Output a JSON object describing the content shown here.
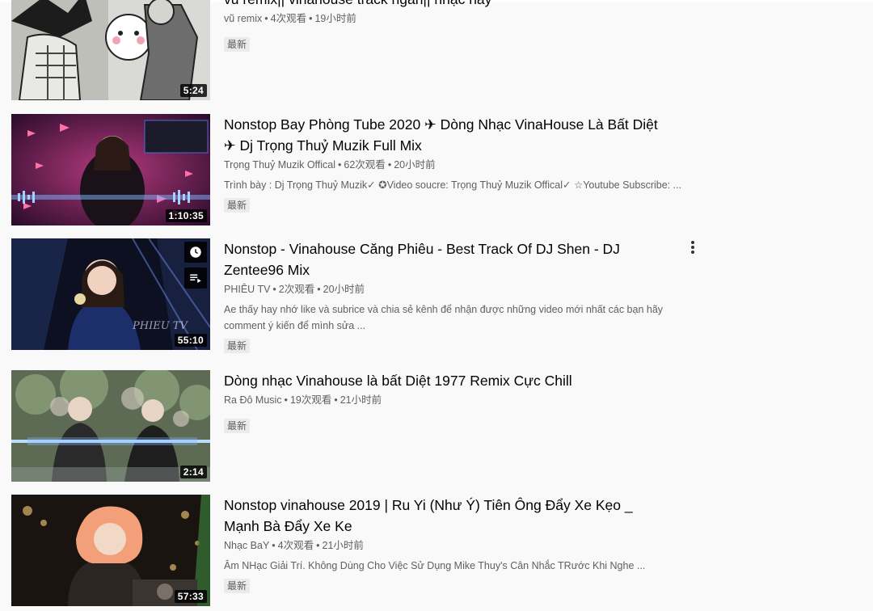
{
  "videos": [
    {
      "title_line1": "vũ remix|| vinahouse track ngắn|| nhạc hay",
      "title_line2": "",
      "channel": "vũ remix",
      "views": "4次观看",
      "age": "19小时前",
      "description": "",
      "badge": "最新",
      "duration": "5:24",
      "thumb_icon": "cartoon-thumbnail"
    },
    {
      "title_line1": "Nonstop Bay Phòng Tube 2020 ✈ Dòng Nhạc VinaHouse Là Bất Diệt",
      "title_line2": "✈ Dj Trọng Thuỷ Muzik Full Mix",
      "channel": "Trọng Thuỷ Muzik Offical",
      "views": "62次观看",
      "age": "20小时前",
      "description": "Trình bày : Dj Trọng Thuỷ Muzik✓ ✪Video soucre: Trọng Thuỷ Muzik Offical✓ ☆Youtube Subscribe: ...",
      "badge": "最新",
      "duration": "1:10:35",
      "thumb_icon": "dj-thumbnail"
    },
    {
      "title_line1": "Nonstop - Vinahouse Căng Phiêu - Best Track Of DJ Shen - DJ",
      "title_line2": "Zentee96 Mix",
      "channel": "PHIÊU TV",
      "views": "2次观看",
      "age": "20小时前",
      "description": "Ae thấy hay nhớ like và subrice và chia sẻ kênh để nhận được những video mới nhất các bạn hãy comment ý kiến để mình sửa ...",
      "badge": "最新",
      "duration": "55:10",
      "thumb_icon": "club-thumbnail",
      "watch_later_icon": "clock-icon",
      "add_queue_icon": "queue-icon",
      "more_icon": "more-vert-icon"
    },
    {
      "title_line1": "Dòng nhạc Vinahouse là bất Diệt 1977 Remix Cực Chill",
      "title_line2": "",
      "channel": "Ra Đô Music",
      "views": "19次观看",
      "age": "21小时前",
      "description": "",
      "badge": "最新",
      "duration": "2:14",
      "thumb_icon": "duo-thumbnail"
    },
    {
      "title_line1": "Nonstop vinahouse 2019 | Ru Yi (Như Ý) Tiên Ông Đẩy Xe Kẹo _",
      "title_line2": "Mạnh Bà Đẩy Xe Ke",
      "channel": "Nhạc BaY",
      "views": "4次观看",
      "age": "21小时前",
      "description": "Âm NHạc Giải Trí. Không Dùng Cho Việc Sử Dụng Mike Thuy's Cân Nhắc TRước Khi Nghe ...",
      "badge": "最新",
      "duration": "57:33",
      "thumb_icon": "blonde-dj-thumbnail"
    }
  ],
  "separator": "•",
  "colors": {
    "background": "#f9f9f9",
    "title": "#030303",
    "secondary": "#606060",
    "badge_bg": "#ebebeb"
  }
}
